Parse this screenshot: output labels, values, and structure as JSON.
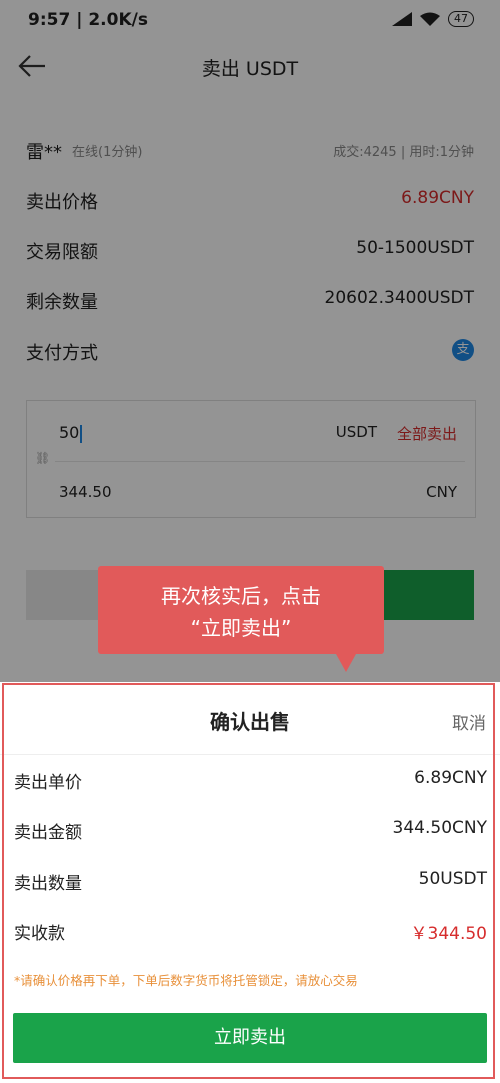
{
  "status_bar": {
    "time_speed": "9:57 | 2.0K/s",
    "battery": "47"
  },
  "nav": {
    "title": "卖出 USDT"
  },
  "seller": {
    "name": "雷**",
    "status": "在线(1分钟)",
    "stats": "成交:4245 | 用时:1分钟"
  },
  "rows": {
    "price_label": "卖出价格",
    "price_value": "6.89CNY",
    "limit_label": "交易限额",
    "limit_value": "50-1500USDT",
    "remaining_label": "剩余数量",
    "remaining_value": "20602.3400USDT",
    "payment_label": "支付方式",
    "payment_icon_text": "支"
  },
  "amount": {
    "input_value": "50",
    "unit": "USDT",
    "sell_all": "全部卖出",
    "cny_value": "344.50",
    "cny_unit": "CNY"
  },
  "tooltip": {
    "line1": "再次核实后，点击",
    "line2": "“立即卖出”"
  },
  "sheet": {
    "title": "确认出售",
    "cancel": "取消",
    "unit_price_label": "卖出单价",
    "unit_price_value": "6.89CNY",
    "amount_label": "卖出金额",
    "amount_value": "344.50CNY",
    "quantity_label": "卖出数量",
    "quantity_value": "50USDT",
    "receive_label": "实收款",
    "receive_value": "￥344.50",
    "notice": "*请确认价格再下单，下单后数字货币将托管锁定，请放心交易",
    "confirm_button": "立即卖出"
  },
  "colors": {
    "accent_red": "#d62c2c",
    "tooltip_red": "#e15a5a",
    "green": "#1aa34a",
    "notice_orange": "#e8903a"
  }
}
